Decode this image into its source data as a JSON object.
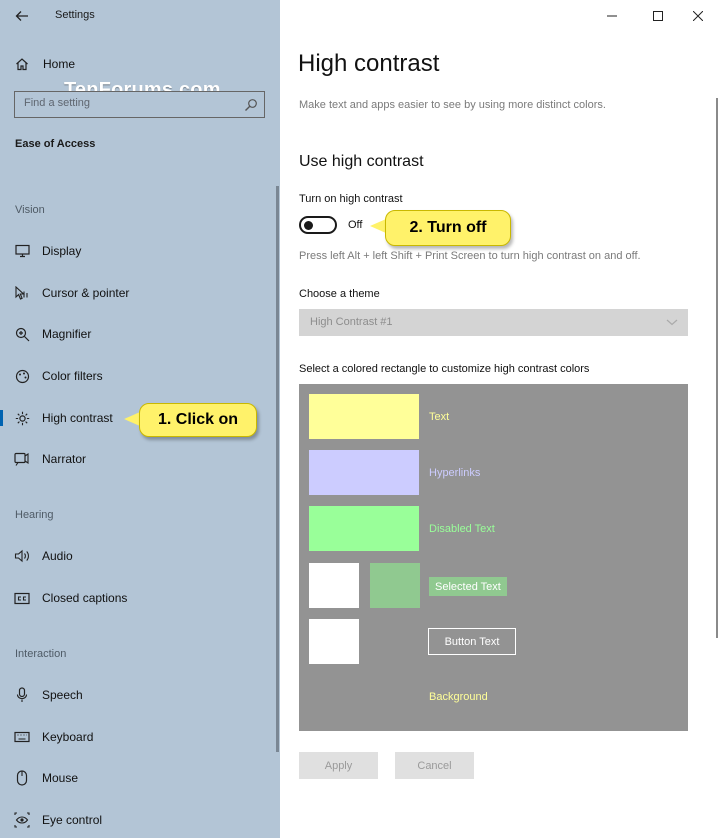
{
  "app": {
    "title": "Settings"
  },
  "watermark": "TenForums.com",
  "sidebar": {
    "home_label": "Home",
    "search_placeholder": "Find a setting",
    "section_title": "Ease of Access",
    "groups": {
      "vision": "Vision",
      "hearing": "Hearing",
      "interaction": "Interaction"
    },
    "items": {
      "display": "Display",
      "cursor": "Cursor & pointer",
      "magnifier": "Magnifier",
      "color_filters": "Color filters",
      "high_contrast": "High contrast",
      "narrator": "Narrator",
      "audio": "Audio",
      "closed_captions": "Closed captions",
      "speech": "Speech",
      "keyboard": "Keyboard",
      "mouse": "Mouse",
      "eye_control": "Eye control"
    },
    "selected": "high_contrast"
  },
  "callouts": {
    "step1": "1. Click on",
    "step2": "2. Turn off",
    "color": "#fff26a"
  },
  "main": {
    "title": "High contrast",
    "description": "Make text and apps easier to see by using more distinct colors.",
    "section": "Use high contrast",
    "toggle_label": "Turn on high contrast",
    "toggle_state": "Off",
    "toggle_on": false,
    "hint": "Press left Alt + left Shift + Print Screen to turn high contrast on and off.",
    "theme_label": "Choose a theme",
    "theme_value": "High Contrast #1",
    "customize_label": "Select a colored rectangle to customize high contrast colors",
    "preview": {
      "background_color": "#939393",
      "text": "Text",
      "text_color": "#ffff99",
      "hyperlinks": "Hyperlinks",
      "hyperlinks_color": "#ccccff",
      "disabled_text": "Disabled Text",
      "disabled_color": "#99ff99",
      "selected_text": "Selected Text",
      "selected_bg_color": "#90c990",
      "button_text": "Button Text",
      "background": "Background",
      "background_label_color": "#ffff99"
    },
    "apply": "Apply",
    "cancel": "Cancel"
  }
}
